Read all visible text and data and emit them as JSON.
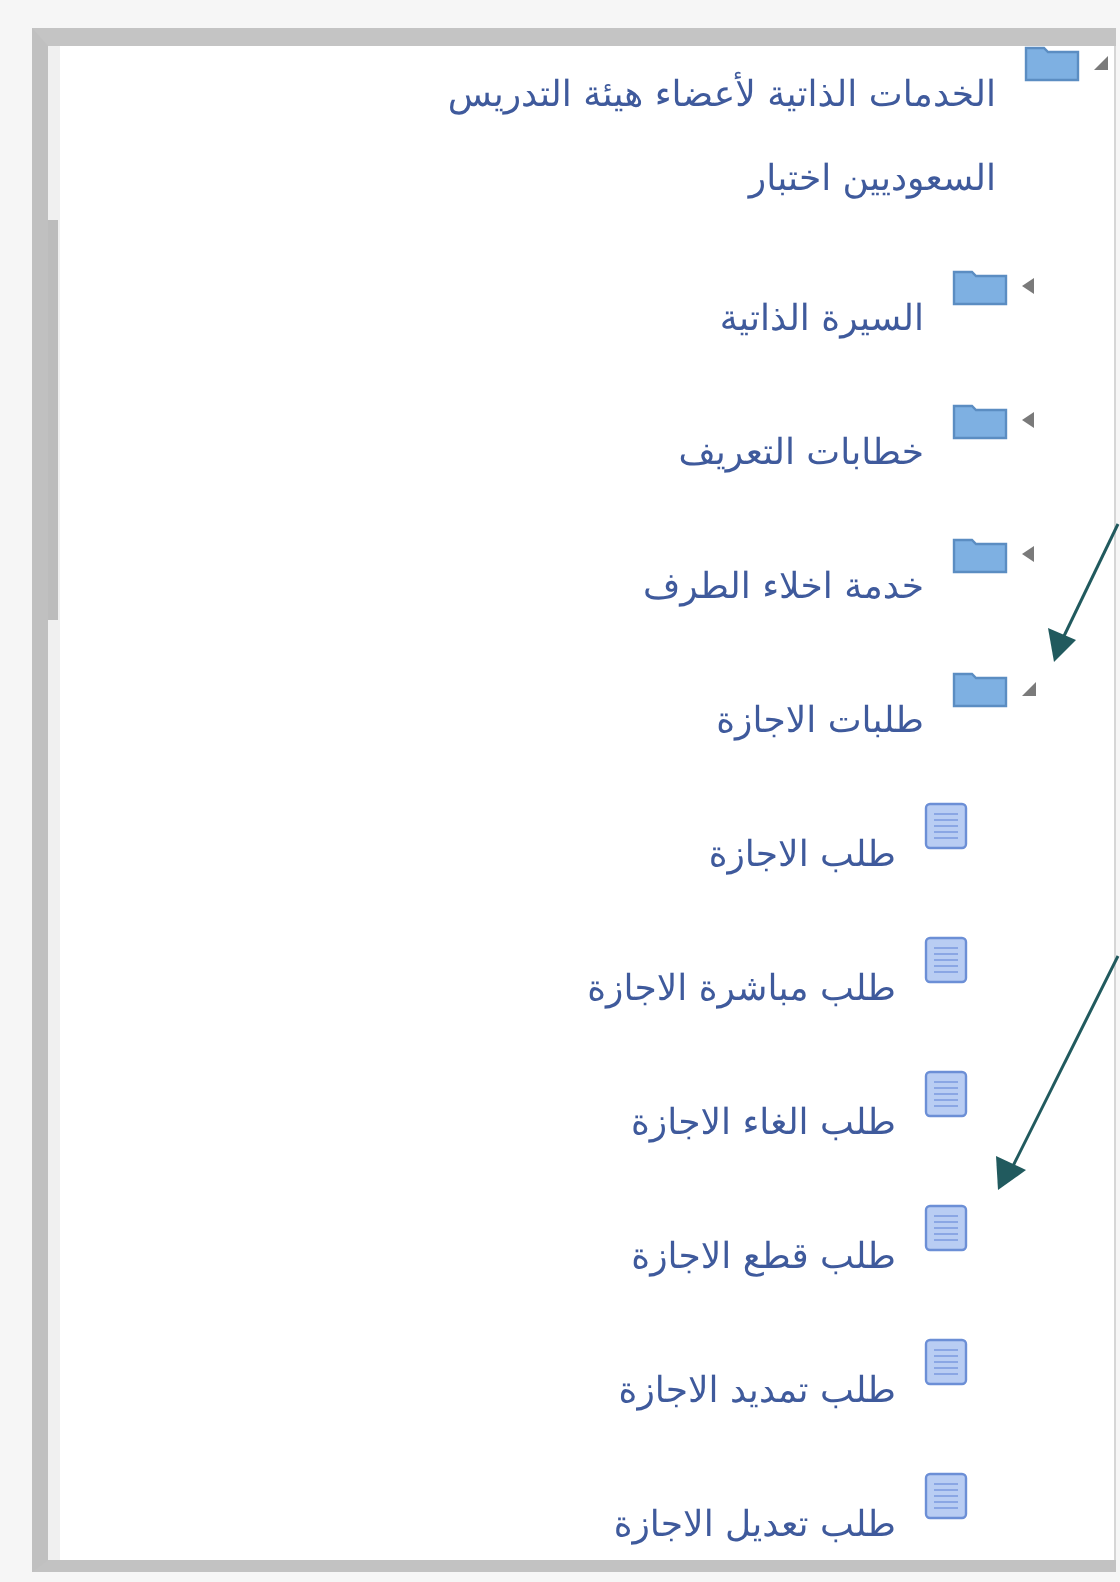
{
  "tree": [
    {
      "label": "الخدمات الذاتية لأعضاء هيئة التدريس السعوديين اختبار",
      "kind": "folder",
      "expanded": true,
      "children": [
        {
          "label": "السيرة الذاتية",
          "kind": "folder",
          "expanded": false
        },
        {
          "label": "خطابات التعريف",
          "kind": "folder",
          "expanded": false
        },
        {
          "label": "خدمة اخلاء الطرف",
          "kind": "folder",
          "expanded": false
        },
        {
          "label": "طلبات الاجازة",
          "kind": "folder",
          "expanded": true,
          "children": [
            {
              "label": "طلب الاجازة",
              "kind": "document"
            },
            {
              "label": "طلب مباشرة الاجازة",
              "kind": "document"
            },
            {
              "label": "طلب الغاء الاجازة",
              "kind": "document"
            },
            {
              "label": "طلب قطع الاجازة",
              "kind": "document"
            },
            {
              "label": "طلب تمديد الاجازة",
              "kind": "document"
            },
            {
              "label": "طلب تعديل الاجازة",
              "kind": "document"
            }
          ]
        }
      ]
    }
  ]
}
